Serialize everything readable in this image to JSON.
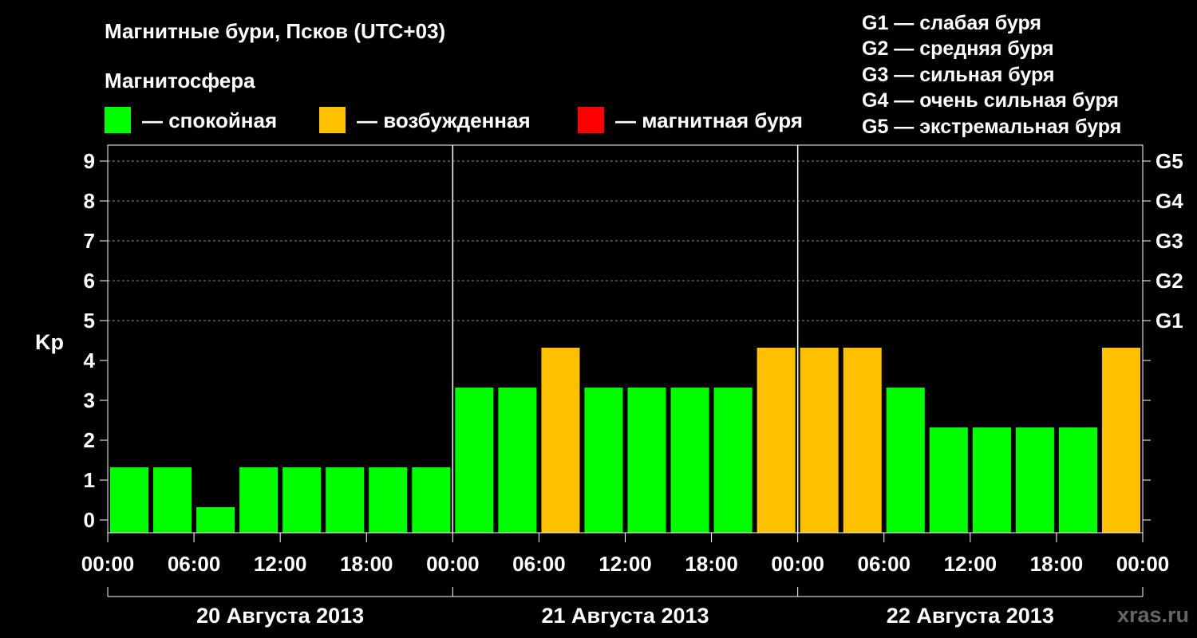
{
  "title": "Магнитные бури, Псков (UTC+03)",
  "legend": {
    "heading": "Магнитосфера",
    "items": [
      {
        "label": "— спокойная",
        "color": "#00ff00"
      },
      {
        "label": "— возбужденная",
        "color": "#ffc000"
      },
      {
        "label": "— магнитная буря",
        "color": "#ff0000"
      }
    ]
  },
  "g_scale": [
    "G1 — слабая буря",
    "G2 — средняя буря",
    "G3 — сильная буря",
    "G4 — очень сильная буря",
    "G5 — экстремальная буря"
  ],
  "watermark": "xras.ru",
  "chart_data": {
    "type": "bar",
    "title": "Магнитные бури, Псков (UTC+03)",
    "ylabel": "Kp",
    "ylim": [
      0,
      9
    ],
    "y_ticks": [
      "0",
      "1",
      "2",
      "3",
      "4",
      "5",
      "6",
      "7",
      "8",
      "9"
    ],
    "right_ticks": [
      {
        "kp": 5,
        "label": "G1"
      },
      {
        "kp": 6,
        "label": "G2"
      },
      {
        "kp": 7,
        "label": "G3"
      },
      {
        "kp": 8,
        "label": "G4"
      },
      {
        "kp": 9,
        "label": "G5"
      }
    ],
    "x_tick_labels": [
      "00:00",
      "06:00",
      "12:00",
      "18:00",
      "00:00",
      "06:00",
      "12:00",
      "18:00",
      "00:00",
      "06:00",
      "12:00",
      "18:00",
      "00:00"
    ],
    "days": [
      "20 Августа 2013",
      "21 Августа 2013",
      "22 Августа 2013"
    ],
    "interval_hours": 3,
    "grid": true,
    "values": [
      1,
      1,
      0,
      1,
      1,
      1,
      1,
      1,
      3,
      3,
      4,
      3,
      3,
      3,
      3,
      4,
      4,
      4,
      3,
      2,
      2,
      2,
      2,
      4
    ],
    "colors": {
      "quiet": "#00ff00",
      "active": "#ffc000",
      "storm": "#ff0000"
    }
  }
}
